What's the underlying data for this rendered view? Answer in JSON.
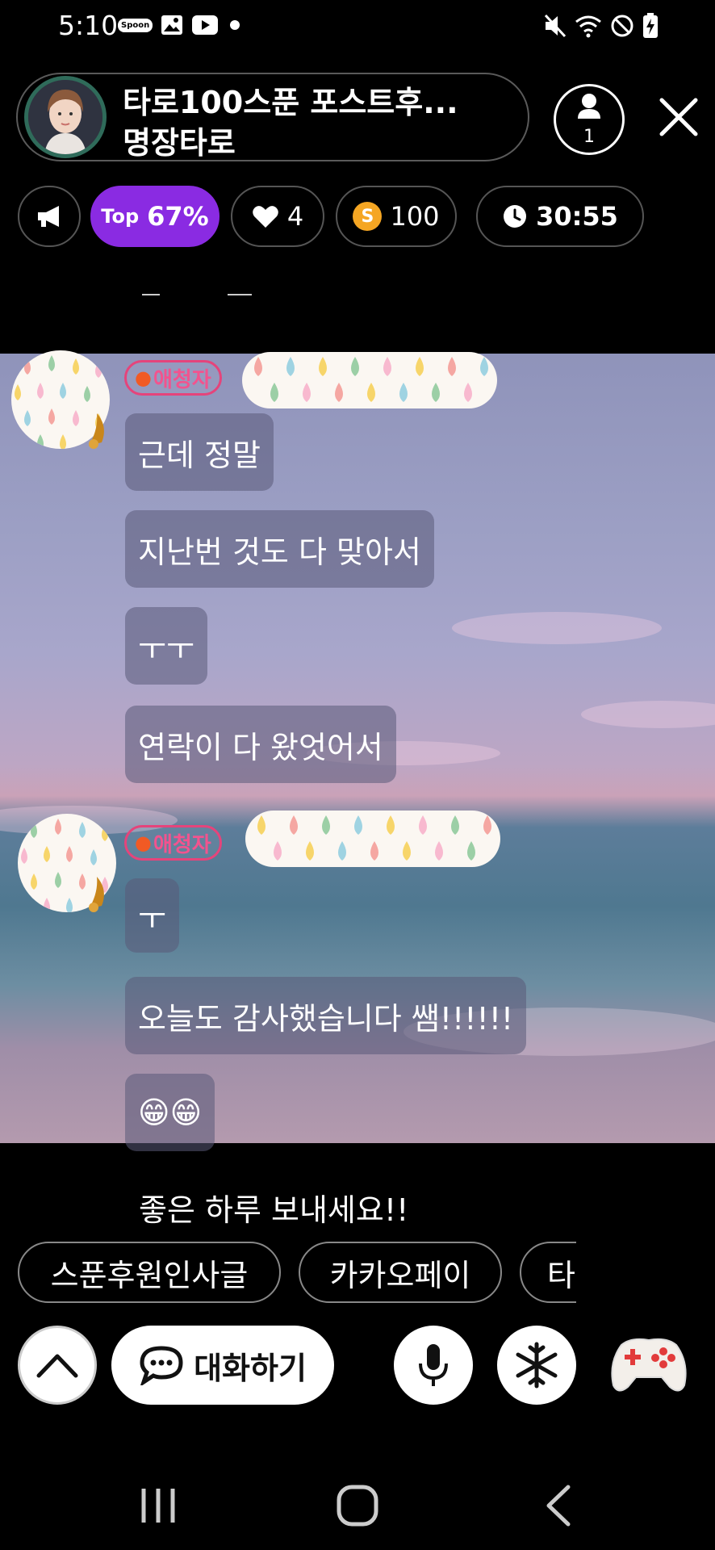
{
  "status_bar": {
    "time": "5:10",
    "spoon_badge": "Spoon"
  },
  "header": {
    "title_line1": "타로100스푼 포스트후...",
    "title_line2": "명장타로",
    "listener_count": "1"
  },
  "chips": {
    "top_prefix": "Top",
    "top_value": "67%",
    "likes": "4",
    "coin_letter": "S",
    "spoons": "100",
    "timer": "30:55"
  },
  "chat": {
    "badge_label": "애청자",
    "group1": [
      "근데 정말",
      "지난번 것도 다 맞아서",
      "ㅜㅜ",
      "연락이 다 왔엇어서"
    ],
    "group2": [
      "ㅜ",
      "오늘도 감사했습니다 쌤!!!!!!",
      "😁😁"
    ]
  },
  "last_message": "좋은 하루 보내세요!!",
  "quick_replies": [
    "스푼후원인사글",
    "카카오페이",
    "타"
  ],
  "bottom_bar": {
    "talk_label": "대화하기"
  },
  "icons": [
    "megaphone-icon",
    "heart-icon",
    "clock-icon",
    "person-icon",
    "close-icon",
    "chevron-up-icon",
    "chat-bubble-icon",
    "mic-icon",
    "snowflake-icon",
    "gamepad-icon",
    "recents-icon",
    "home-icon",
    "back-icon"
  ],
  "colors": {
    "accent_purple": "#8a2be2",
    "badge_pink": "#f2538e",
    "coin_orange": "#f5a623"
  }
}
